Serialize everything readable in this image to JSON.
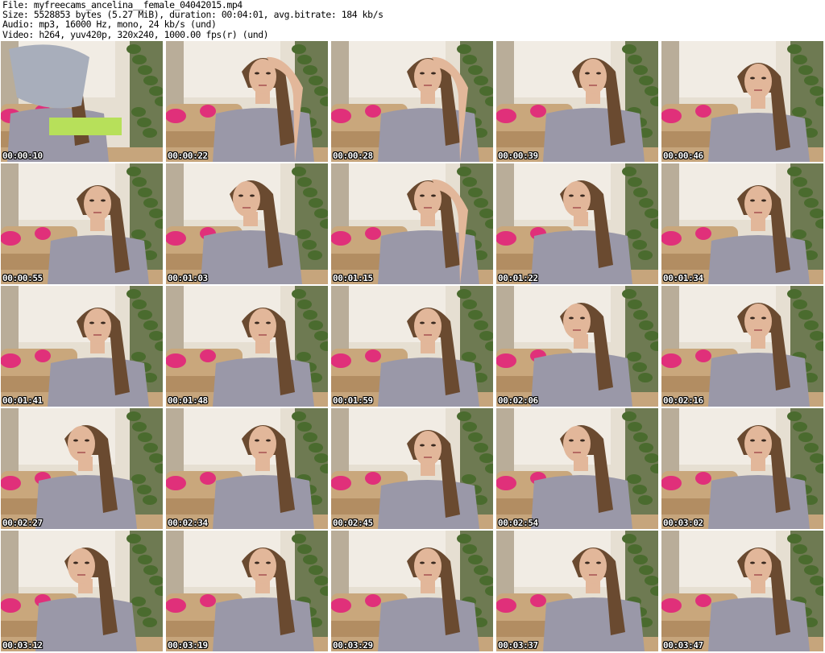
{
  "header": {
    "lines": [
      "File: myfreecams_ancelina__female_04042015.mp4",
      "Size: 5528853 bytes (5.27 MiB), duration: 00:04:01, avg.bitrate: 184 kb/s",
      "Audio: mp3, 16000 Hz, mono, 24 kb/s (und)",
      "Video: h264, yuv420p, 320x240, 1000.00 fps(r) (und)"
    ]
  },
  "thumbnails": [
    {
      "time": "00:00:10",
      "pose": "undressing"
    },
    {
      "time": "00:00:22",
      "pose": "hand-up-right"
    },
    {
      "time": "00:00:28",
      "pose": "hand-hair"
    },
    {
      "time": "00:00:39",
      "pose": "face-front"
    },
    {
      "time": "00:00:46",
      "pose": "face-down"
    },
    {
      "time": "00:00:55",
      "pose": "face-down"
    },
    {
      "time": "00:01:03",
      "pose": "face-side"
    },
    {
      "time": "00:01:15",
      "pose": "hand-hair"
    },
    {
      "time": "00:01:22",
      "pose": "face-side"
    },
    {
      "time": "00:01:34",
      "pose": "face-down"
    },
    {
      "time": "00:01:41",
      "pose": "face-down"
    },
    {
      "time": "00:01:48",
      "pose": "face-down"
    },
    {
      "time": "00:01:59",
      "pose": "face-down"
    },
    {
      "time": "00:02:06",
      "pose": "face-side"
    },
    {
      "time": "00:02:16",
      "pose": "face-front"
    },
    {
      "time": "00:02:27",
      "pose": "face-side"
    },
    {
      "time": "00:02:34",
      "pose": "face-front"
    },
    {
      "time": "00:02:45",
      "pose": "face-down"
    },
    {
      "time": "00:02:54",
      "pose": "face-side"
    },
    {
      "time": "00:03:02",
      "pose": "face-front"
    },
    {
      "time": "00:03:12",
      "pose": "face-side"
    },
    {
      "time": "00:03:19",
      "pose": "face-front"
    },
    {
      "time": "00:03:29",
      "pose": "face-front"
    },
    {
      "time": "00:03:37",
      "pose": "face-front"
    },
    {
      "time": "00:03:47",
      "pose": "face-front"
    }
  ],
  "colors": {
    "wall": "#e6dfd2",
    "sofa": "#c9a77c",
    "pillow": "#e0307a",
    "plant": "#4a6b2e",
    "shirt": "#9a98a8",
    "hair": "#6a4a30",
    "skin": "#e2b79a"
  }
}
